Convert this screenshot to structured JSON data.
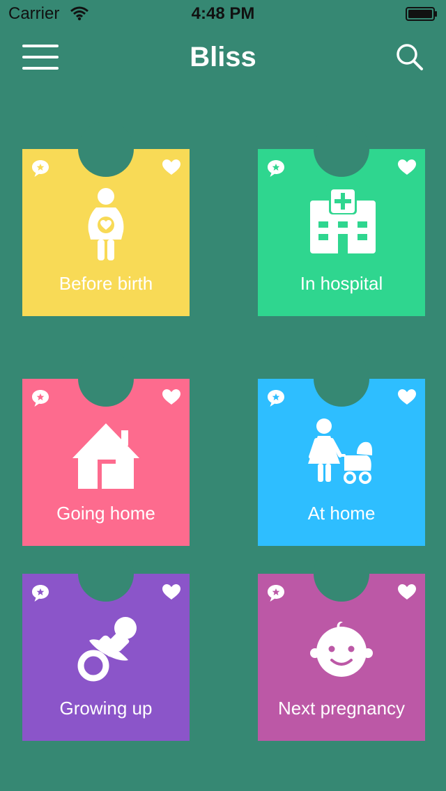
{
  "status": {
    "carrier": "Carrier",
    "time": "4:48 PM"
  },
  "nav": {
    "title": "Bliss"
  },
  "colors": {
    "background": "#368873",
    "cards": [
      "#F8DA56",
      "#2FD68F",
      "#FD6B8E",
      "#2EBEFF",
      "#8B55C9",
      "#BC58A6"
    ]
  },
  "cards": [
    {
      "label": "Before birth",
      "icon": "pregnant-woman-icon"
    },
    {
      "label": "In hospital",
      "icon": "hospital-icon"
    },
    {
      "label": "Going home",
      "icon": "house-icon"
    },
    {
      "label": "At home",
      "icon": "mother-stroller-icon"
    },
    {
      "label": "Growing up",
      "icon": "pacifier-icon"
    },
    {
      "label": "Next pregnancy",
      "icon": "baby-face-icon"
    }
  ]
}
